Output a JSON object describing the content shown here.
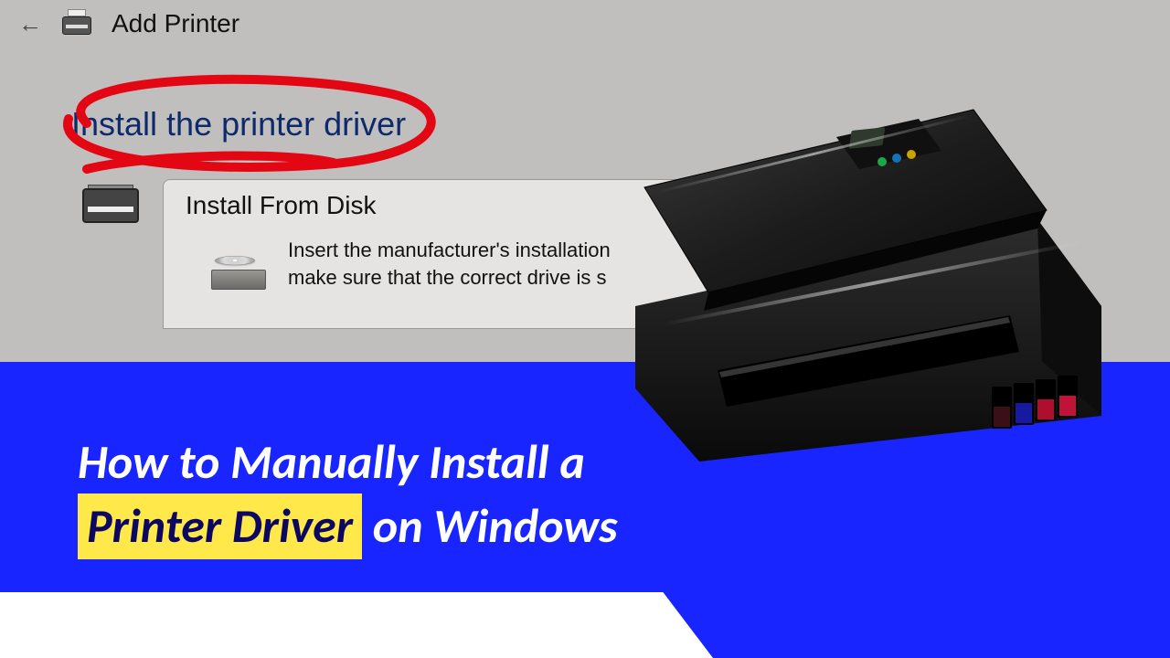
{
  "header": {
    "back_icon": "back-arrow-icon",
    "title": "Add Printer"
  },
  "install_heading": "Install the printer driver",
  "dialog": {
    "title": "Install From Disk",
    "close": "×",
    "body_line1": "Insert the manufacturer's installation",
    "body_line2": "make sure that the correct drive is s"
  },
  "banner": {
    "line1": "How to Manually Install a",
    "highlight": "Printer Driver",
    "line2_tail": "on Windows"
  },
  "colors": {
    "blue": "#1825ff",
    "highlight": "#ffe94a",
    "scribble": "#e30613"
  }
}
